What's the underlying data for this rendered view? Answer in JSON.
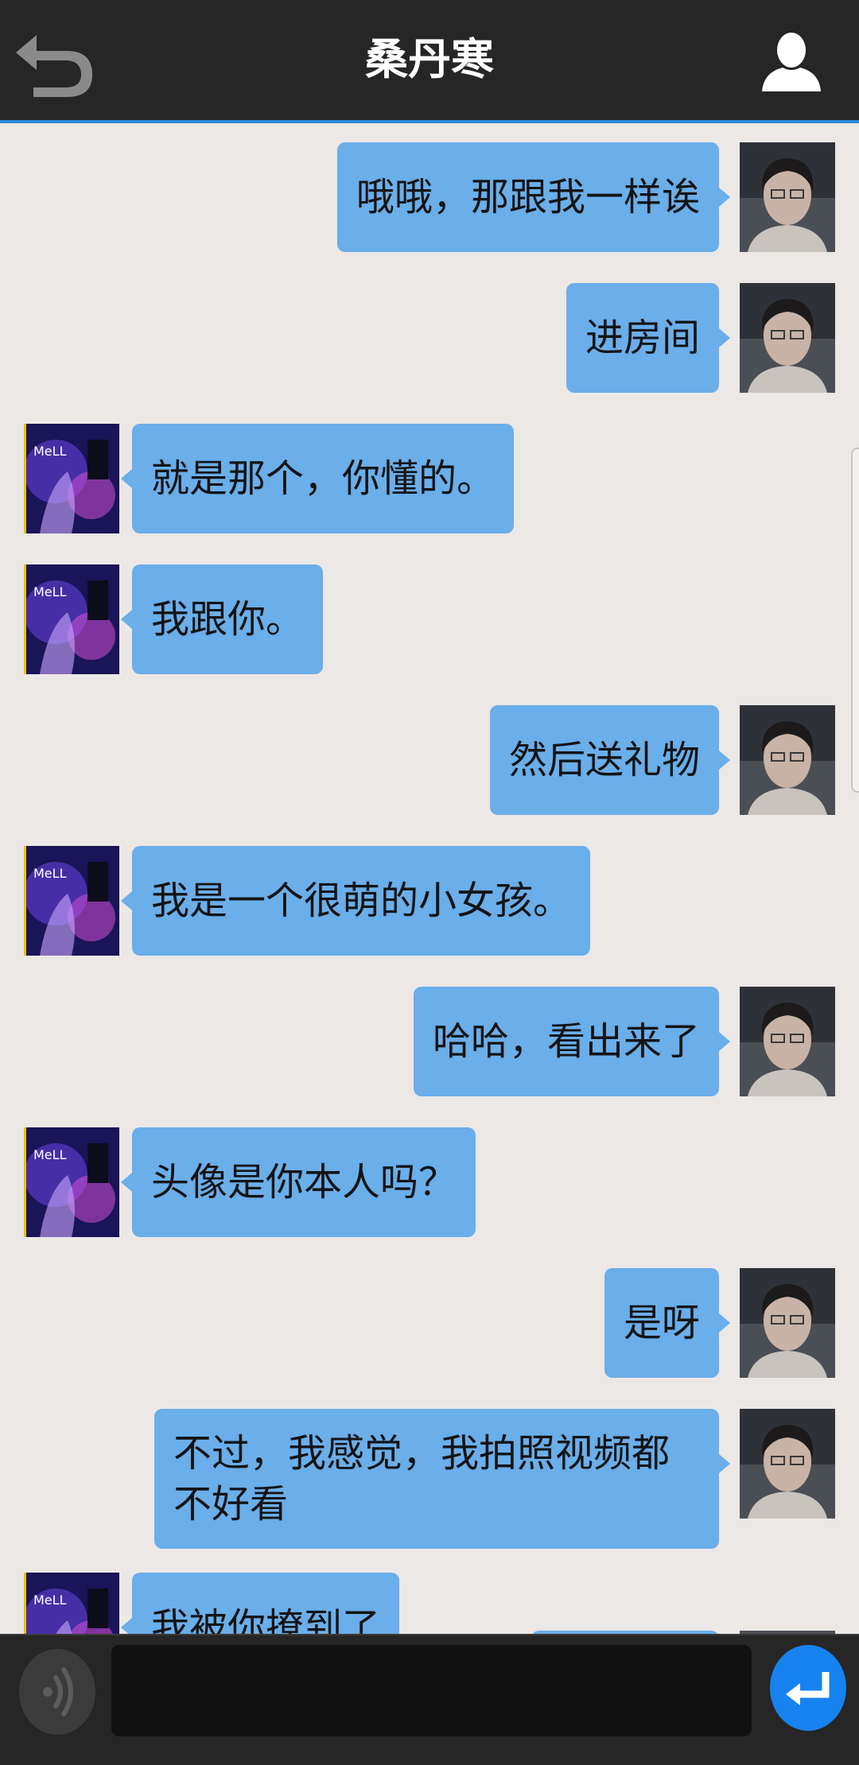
{
  "header": {
    "title": "桑丹寒"
  },
  "messages": [
    {
      "side": "me",
      "text": "哦哦，那跟我一样诶"
    },
    {
      "side": "me",
      "text": "进房间"
    },
    {
      "side": "other",
      "text": "就是那个，你懂的。"
    },
    {
      "side": "other",
      "text": "我跟你。"
    },
    {
      "side": "me",
      "text": "然后送礼物"
    },
    {
      "side": "other",
      "text": "我是一个很萌的小女孩。"
    },
    {
      "side": "me",
      "text": "哈哈，看出来了"
    },
    {
      "side": "other",
      "text": "头像是你本人吗？"
    },
    {
      "side": "me",
      "text": "是呀"
    },
    {
      "side": "me",
      "text": "不过，我感觉，我拍照视频都不好看"
    },
    {
      "side": "other",
      "text": "我被你撩到了"
    }
  ],
  "input": {
    "value": "",
    "placeholder": ""
  },
  "icons": {
    "back": "back-arrow-icon",
    "profile": "user-icon",
    "voice": "voice-icon",
    "send": "enter-icon"
  },
  "colors": {
    "header_bg": "#262626",
    "accent_line": "#2f86d6",
    "chat_bg": "#ece8e6",
    "bubble": "#6aaeea",
    "send_button": "#1683f0"
  }
}
